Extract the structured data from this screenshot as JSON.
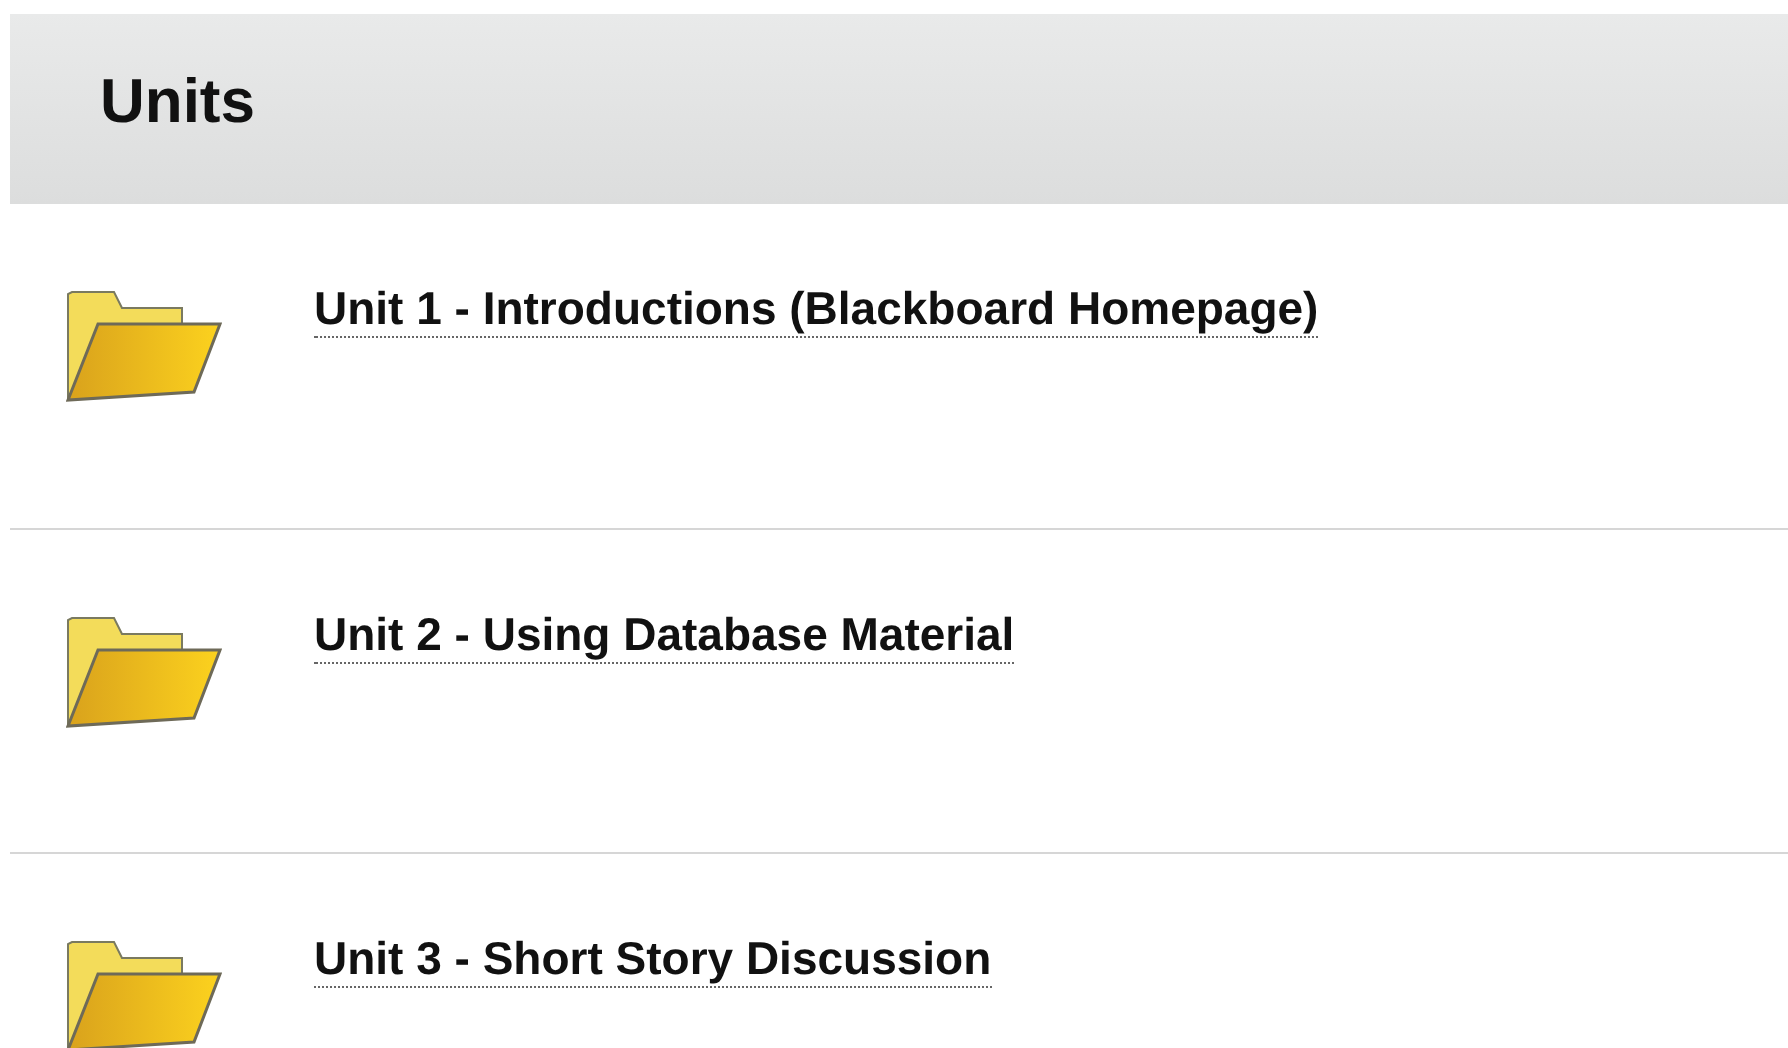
{
  "header": {
    "title": "Units"
  },
  "units": [
    {
      "title": "Unit 1 - Introductions (Blackboard Homepage)"
    },
    {
      "title": "Unit 2 - Using Database Material"
    },
    {
      "title": "Unit 3 - Short Story Discussion"
    }
  ]
}
